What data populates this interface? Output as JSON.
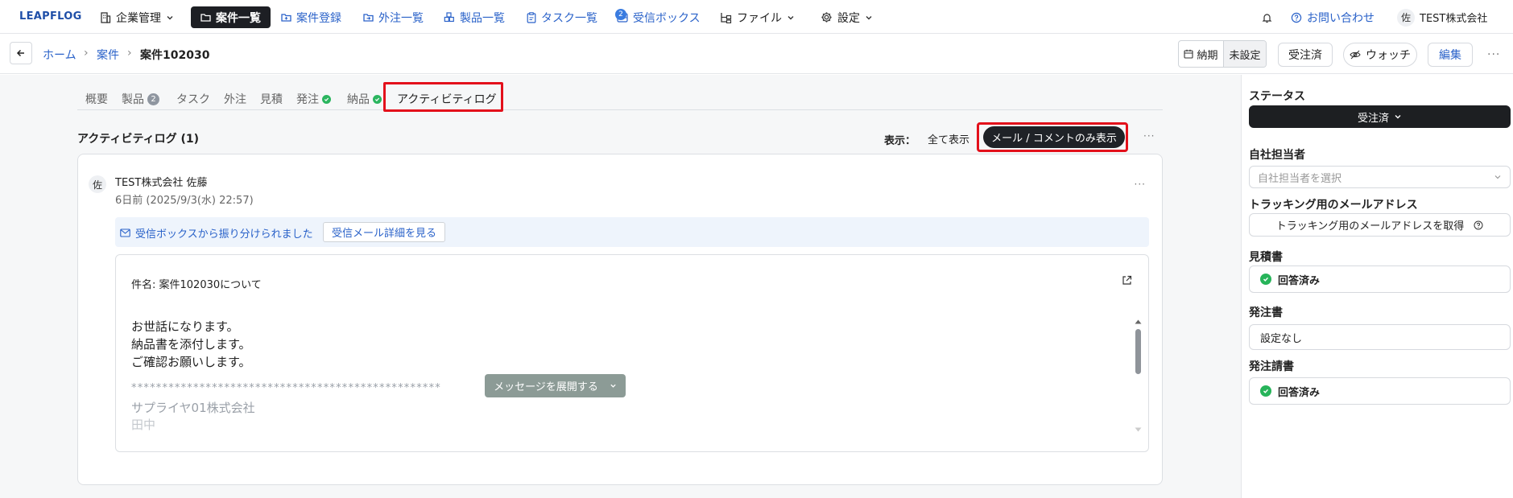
{
  "app": {
    "logo": "LEAPFLOG"
  },
  "nav": {
    "company_mgmt": "企業管理",
    "projects_list": "案件一覧",
    "project_register": "案件登録",
    "outsourcing_list": "外注一覧",
    "products_list": "製品一覧",
    "tasks_list": "タスク一覧",
    "inbox": "受信ボックス",
    "inbox_badge": "2",
    "files": "ファイル",
    "settings": "設定",
    "contact": "お問い合わせ",
    "user_avatar": "佐",
    "company_name": "TEST株式会社"
  },
  "breadcrumb": {
    "home": "ホーム",
    "projects": "案件",
    "current": "案件102030"
  },
  "toolbar": {
    "due_label": "納期",
    "due_value": "未設定",
    "order_received": "受注済",
    "watch": "ウォッチ",
    "edit": "編集",
    "more": "···"
  },
  "tabs": [
    {
      "label": "概要"
    },
    {
      "label": "製品",
      "count": "2"
    },
    {
      "label": "タスク"
    },
    {
      "label": "外注"
    },
    {
      "label": "見積"
    },
    {
      "label": "発注"
    },
    {
      "label": "納品"
    },
    {
      "label": "アクティビティログ"
    }
  ],
  "activity": {
    "title": "アクティビティログ (1)",
    "display_label": "表示：",
    "filter_all": "全て表示",
    "filter_mail": "メール / コメントのみ表示",
    "more": "···"
  },
  "entry": {
    "avatar": "佐",
    "author": "TEST株式会社 佐藤",
    "timestamp": "6日前 (2025/9/3(水) 22:57)",
    "more": "···",
    "notice_text": "受信ボックスから振り分けられました",
    "notice_button": "受信メール詳細を見る",
    "subject": "件名: 案件102030について",
    "body_lines": [
      "お世話になります。",
      "納品書を添付します。",
      "ご確認お願いします。",
      "**************************************************",
      "サプライヤ01株式会社",
      "田中"
    ],
    "expand_button": "メッセージを展開する"
  },
  "side": {
    "status_label": "ステータス",
    "status_value": "受注済",
    "owner_label": "自社担当者",
    "owner_placeholder": "自社担当者を選択",
    "tracking_label": "トラッキング用のメールアドレス",
    "tracking_button": "トラッキング用のメールアドレスを取得",
    "quote_label": "見積書",
    "quote_value": "回答済み",
    "po_label": "発注書",
    "po_value": "設定なし",
    "invoice_label": "発注請書",
    "invoice_value": "回答済み"
  },
  "colors": {
    "accent_blue": "#2a62c9",
    "highlight_red": "#e3101b",
    "success_green": "#27b45a",
    "dark": "#1d1f24"
  }
}
